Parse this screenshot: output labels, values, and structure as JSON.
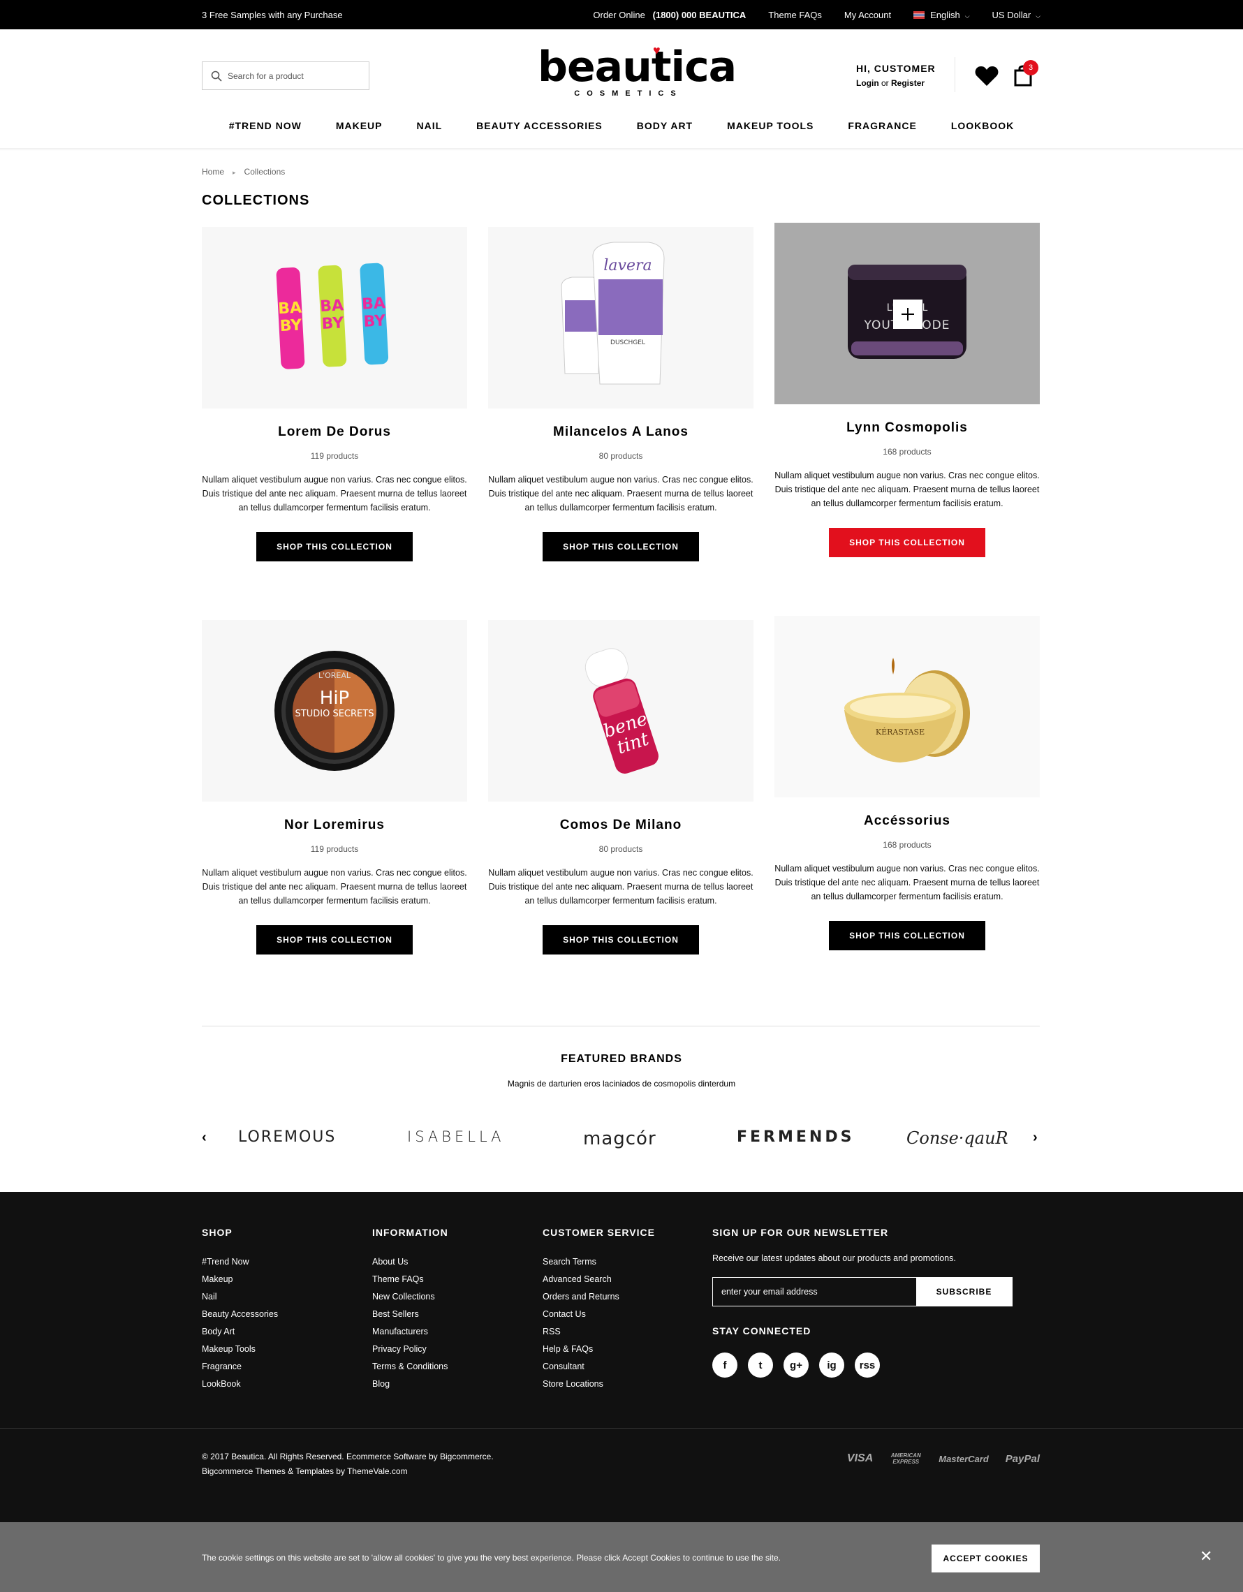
{
  "topbar": {
    "promo": "3 Free Samples with any Purchase",
    "order_label": "Order Online",
    "order_phone": "(1800) 000 BEAUTICA",
    "theme_faqs": "Theme FAQs",
    "my_account": "My Account",
    "language": "English",
    "currency": "US Dollar"
  },
  "header": {
    "search_placeholder": "Search for a product",
    "logo_word": "beautica",
    "logo_sub": "COSMETICS",
    "greeting": "HI, CUSTOMER",
    "login": "Login",
    "or": "or",
    "register": "Register",
    "cart_count": "3"
  },
  "nav": [
    "#TREND NOW",
    "MAKEUP",
    "NAIL",
    "BEAUTY ACCESSORIES",
    "BODY ART",
    "MAKEUP TOOLS",
    "FRAGRANCE",
    "LOOKBOOK"
  ],
  "breadcrumb": {
    "home": "Home",
    "current": "Collections"
  },
  "page_title": "COLLECTIONS",
  "collections": [
    {
      "name": "Lorem De Dorus",
      "count": "119 products",
      "desc": "Nullam aliquet vestibulum augue non varius. Cras nec congue elitos. Duis tristique del ante nec aliquam. Praesent murna de tellus laoreet an tellus dullamcorper fermentum facilisis eratum.",
      "button": "SHOP THIS COLLECTION"
    },
    {
      "name": "Milancelos A Lanos",
      "count": "80 products",
      "desc": "Nullam aliquet vestibulum augue non varius. Cras nec congue elitos. Duis tristique del ante nec aliquam. Praesent murna de tellus laoreet an tellus dullamcorper fermentum facilisis eratum.",
      "button": "SHOP THIS COLLECTION"
    },
    {
      "name": "Lynn Cosmopolis",
      "count": "168 products",
      "desc": "Nullam aliquet vestibulum augue non varius. Cras nec congue elitos. Duis tristique del ante nec aliquam. Praesent murna de tellus laoreet an tellus dullamcorper fermentum facilisis eratum.",
      "button": "SHOP THIS COLLECTION"
    },
    {
      "name": "Nor Loremirus",
      "count": "119 products",
      "desc": "Nullam aliquet vestibulum augue non varius. Cras nec congue elitos. Duis tristique del ante nec aliquam. Praesent murna de tellus laoreet an tellus dullamcorper fermentum facilisis eratum.",
      "button": "SHOP THIS COLLECTION"
    },
    {
      "name": "Comos De Milano",
      "count": "80 products",
      "desc": "Nullam aliquet vestibulum augue non varius. Cras nec congue elitos. Duis tristique del ante nec aliquam. Praesent murna de tellus laoreet an tellus dullamcorper fermentum facilisis eratum.",
      "button": "SHOP THIS COLLECTION"
    },
    {
      "name": "Accéssorius",
      "count": "168 products",
      "desc": "Nullam aliquet vestibulum augue non varius. Cras nec congue elitos. Duis tristique del ante nec aliquam. Praesent murna de tellus laoreet an tellus dullamcorper fermentum facilisis eratum.",
      "button": "SHOP THIS COLLECTION"
    }
  ],
  "product_labels": {
    "lip1": "BABY LIPS",
    "lavera": "lavera",
    "lavera_sub": "DUSCHGEL",
    "jar_brand": "L'ORÉAL",
    "jar_line": "YOUTH CODE",
    "shadow_brand": "L'OREAL",
    "shadow_line": "HIP",
    "shadow_sub": "STUDIO SECRETS",
    "tint": "bene tint",
    "kerastase": "KÉRASTASE"
  },
  "featured": {
    "title": "FEATURED BRANDS",
    "subtitle": "Magnis de darturien eros laciniados de cosmopolis dinterdum",
    "brands": [
      "LOREMOUS",
      "ISABELLA",
      "magcór",
      "FERMENDS",
      "Conse·qauR"
    ]
  },
  "footer": {
    "shop": {
      "title": "SHOP",
      "links": [
        "#Trend Now",
        "Makeup",
        "Nail",
        "Beauty Accessories",
        "Body Art",
        "Makeup Tools",
        "Fragrance",
        "LookBook"
      ]
    },
    "info": {
      "title": "INFORMATION",
      "links": [
        "About Us",
        "Theme FAQs",
        "New Collections",
        "Best Sellers",
        "Manufacturers",
        "Privacy Policy",
        "Terms & Conditions",
        "Blog"
      ]
    },
    "service": {
      "title": "CUSTOMER SERVICE",
      "links": [
        "Search Terms",
        "Advanced Search",
        "Orders and Returns",
        "Contact Us",
        "RSS",
        "Help & FAQs",
        "Consultant",
        "Store Locations"
      ]
    },
    "newsletter": {
      "title": "SIGN UP FOR OUR NEWSLETTER",
      "text": "Receive our latest updates about our products and promotions.",
      "placeholder": "enter your email address",
      "button": "SUBSCRIBE",
      "connected": "STAY CONNECTED"
    },
    "social": [
      "f",
      "t",
      "g+",
      "ig",
      "rss"
    ],
    "copyright_1": "© 2017 Beautica. All Rights Reserved. Ecommerce Software by Bigcommerce.",
    "copyright_2": "Bigcommerce Themes & Templates by ThemeVale.com",
    "payments": [
      "VISA",
      "AMERICAN EXPRESS",
      "MasterCard",
      "PayPal"
    ]
  },
  "cookie": {
    "text": "The cookie settings on this website are set to 'allow all cookies' to give you the very best experience. Please click Accept Cookies to continue to use the site.",
    "accept": "ACCEPT COOKIES"
  },
  "colors": {
    "accent": "#e2101d",
    "footer_bg": "#111111",
    "cookie_bg": "#6b6b6b"
  }
}
